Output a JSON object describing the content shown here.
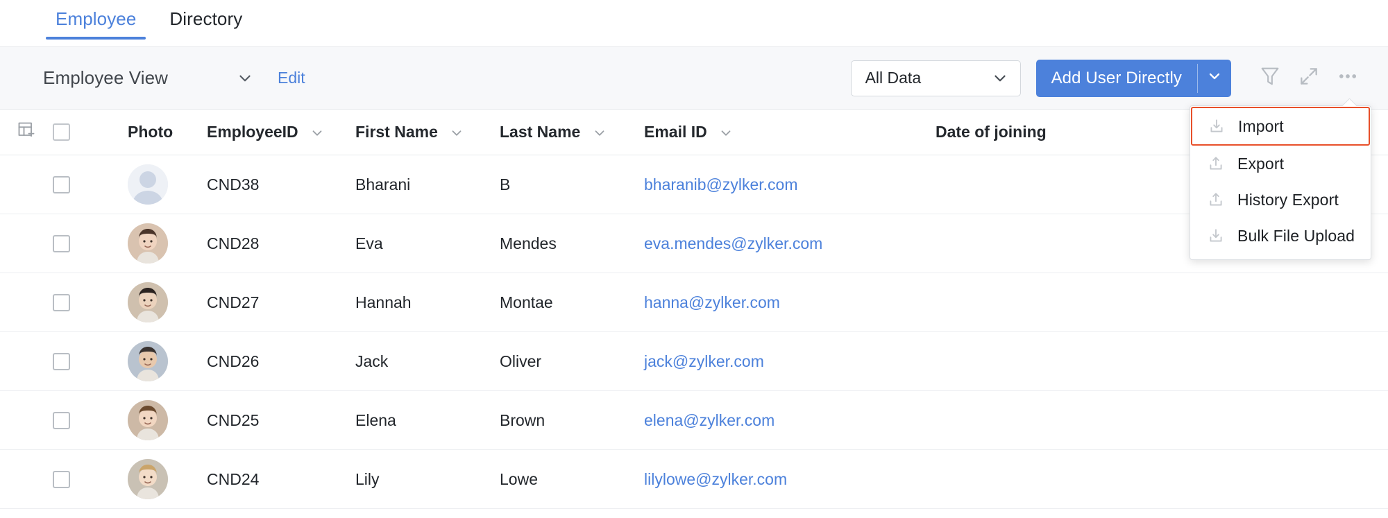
{
  "tabs": [
    {
      "label": "Employee",
      "active": true
    },
    {
      "label": "Directory",
      "active": false
    }
  ],
  "toolbar": {
    "view_name": "Employee View",
    "view_caret_icon": "chevron-down-icon",
    "edit_label": "Edit",
    "data_filter_value": "All Data",
    "data_filter_caret_icon": "chevron-down-icon",
    "add_user_label": "Add User Directly",
    "add_user_caret_icon": "chevron-down-icon",
    "filter_icon": "filter-funnel-icon",
    "expand_icon": "expand-arrows-icon",
    "more_icon": "more-horizontal-icon",
    "accent_color": "#4c81db"
  },
  "menu": {
    "highlight_color": "#e8502a",
    "items": [
      {
        "label": "Import",
        "icon": "download-icon",
        "highlighted": true
      },
      {
        "label": "Export",
        "icon": "upload-icon",
        "highlighted": false
      },
      {
        "label": "History Export",
        "icon": "upload-icon",
        "highlighted": false
      },
      {
        "label": "Bulk File Upload",
        "icon": "download-icon",
        "highlighted": false
      }
    ]
  },
  "table": {
    "add_column_icon": "add-column-icon",
    "select_all_checked": false,
    "columns": [
      {
        "key": "photo",
        "label": "Photo",
        "sortable": false
      },
      {
        "key": "employee_id",
        "label": "EmployeeID",
        "sortable": true
      },
      {
        "key": "first_name",
        "label": "First Name",
        "sortable": true
      },
      {
        "key": "last_name",
        "label": "Last Name",
        "sortable": true
      },
      {
        "key": "email",
        "label": "Email ID",
        "sortable": true
      },
      {
        "key": "date_of_joining",
        "label": "Date of joining",
        "sortable": false
      }
    ],
    "rows": [
      {
        "checked": false,
        "avatar": "placeholder",
        "employee_id": "CND38",
        "first_name": "Bharani",
        "last_name": "B",
        "email": "bharanib@zylker.com",
        "date_of_joining": ""
      },
      {
        "checked": false,
        "avatar": "photo",
        "employee_id": "CND28",
        "first_name": "Eva",
        "last_name": "Mendes",
        "email": "eva.mendes@zylker.com",
        "date_of_joining": ""
      },
      {
        "checked": false,
        "avatar": "photo",
        "employee_id": "CND27",
        "first_name": "Hannah",
        "last_name": "Montae",
        "email": "hanna@zylker.com",
        "date_of_joining": ""
      },
      {
        "checked": false,
        "avatar": "photo",
        "employee_id": "CND26",
        "first_name": "Jack",
        "last_name": "Oliver",
        "email": "jack@zylker.com",
        "date_of_joining": ""
      },
      {
        "checked": false,
        "avatar": "photo",
        "employee_id": "CND25",
        "first_name": "Elena",
        "last_name": "Brown",
        "email": "elena@zylker.com",
        "date_of_joining": ""
      },
      {
        "checked": false,
        "avatar": "photo",
        "employee_id": "CND24",
        "first_name": "Lily",
        "last_name": "Lowe",
        "email": "lilylowe@zylker.com",
        "date_of_joining": ""
      }
    ]
  }
}
